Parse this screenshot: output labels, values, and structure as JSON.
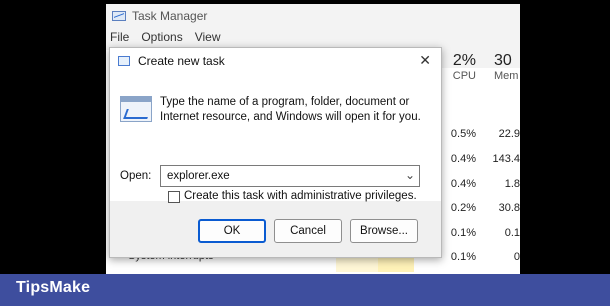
{
  "taskmanager": {
    "title": "Task Manager",
    "menu": [
      "File",
      "Options",
      "View"
    ],
    "cpu": {
      "percent": "2%",
      "label": "CPU",
      "values": [
        "0.5%",
        "0.4%",
        "0.4%",
        "0.2%",
        "0.1%",
        "0.1%"
      ]
    },
    "mem": {
      "percent": "30",
      "label": "Mem",
      "values": [
        "22.9",
        "143.4",
        "1.8",
        "30.8",
        "0.1",
        "0"
      ]
    },
    "bottom_process": "System interrupts"
  },
  "dialog": {
    "title": "Create new task",
    "close": "✕",
    "description": "Type the name of a program, folder, document or Internet resource, and Windows will open it for you.",
    "open_label": "Open:",
    "open_value": "explorer.exe",
    "admin_label": "Create this task with administrative privileges.",
    "admin_checked": false,
    "buttons": {
      "ok": "OK",
      "cancel": "Cancel",
      "browse": "Browse..."
    }
  },
  "watermark": {
    "brand": "TipsMake"
  }
}
